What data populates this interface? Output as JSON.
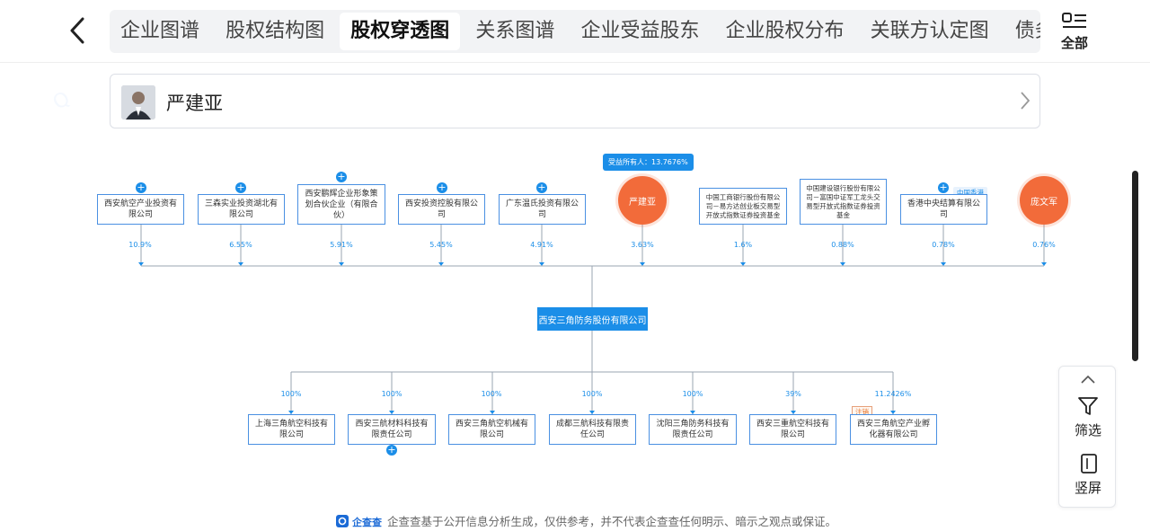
{
  "header": {
    "tabs": [
      {
        "label": "企业图谱",
        "active": false
      },
      {
        "label": "股权结构图",
        "active": false
      },
      {
        "label": "股权穿透图",
        "active": true
      },
      {
        "label": "关系图谱",
        "active": false
      },
      {
        "label": "企业受益股东",
        "active": false
      },
      {
        "label": "企业股权分布",
        "active": false
      },
      {
        "label": "关联方认定图",
        "active": false
      },
      {
        "label": "债务/债权",
        "active": false
      }
    ],
    "all_label": "全部"
  },
  "person": {
    "name": "严建亚"
  },
  "diagram": {
    "shareholders": [
      {
        "name": "西安航空产业投资有限公司",
        "pct": "10.9%",
        "expandable": true
      },
      {
        "name": "三森实业投资湖北有限公司",
        "pct": "6.55%",
        "expandable": true
      },
      {
        "name": "西安鹏辉企业形象策划合伙企业（有限合伙）",
        "pct": "5.91%",
        "expandable": true
      },
      {
        "name": "西安投资控股有限公司",
        "pct": "5.45%",
        "expandable": true
      },
      {
        "name": "广东温氏投资有限公司",
        "pct": "4.91%",
        "expandable": true
      },
      {
        "name": "严建亚",
        "pct": "3.63%",
        "person": true
      },
      {
        "name": "中国工商银行股份有限公司－易方达创业板交易型开放式指数证券投资基金",
        "pct": "1.6%",
        "expandable": false
      },
      {
        "name": "中国建设银行股份有限公司－富国中证军工龙头交易型开放式指数证券投资基金",
        "pct": "0.88%",
        "expandable": false
      },
      {
        "name": "香港中央结算有限公司",
        "pct": "0.78%",
        "expandable": true,
        "tag": "中国香港"
      },
      {
        "name": "庞文军",
        "pct": "0.76%",
        "person": true
      }
    ],
    "beneficiary_tooltip": "受益所有人：13.7676%",
    "center": "西安三角防务股份有限公司",
    "subsidiaries": [
      {
        "name": "上海三角航空科技有限公司",
        "pct": "100%"
      },
      {
        "name": "西安三航材料科技有限责任公司",
        "pct": "100%",
        "expandable": true
      },
      {
        "name": "西安三角航空机械有限公司",
        "pct": "100%"
      },
      {
        "name": "成都三航科技有限责任公司",
        "pct": "100%"
      },
      {
        "name": "沈阳三角防务科技有限责任公司",
        "pct": "100%"
      },
      {
        "name": "西安三重航空科技有限公司",
        "pct": "39%"
      },
      {
        "name": "西安三角航空产业孵化器有限公司",
        "pct": "11.2426%",
        "tag": "注销"
      }
    ]
  },
  "side": {
    "filter_label": "筛选",
    "portrait_label": "竖屏"
  },
  "footer": {
    "brand": "企查查",
    "text": "企查查基于公开信息分析生成，仅供参考，并不代表企查查任何明示、暗示之观点或保证。"
  },
  "colors": {
    "accent": "#1b8ee8",
    "person": "#f26b3a",
    "cancel": "#e6762e"
  }
}
